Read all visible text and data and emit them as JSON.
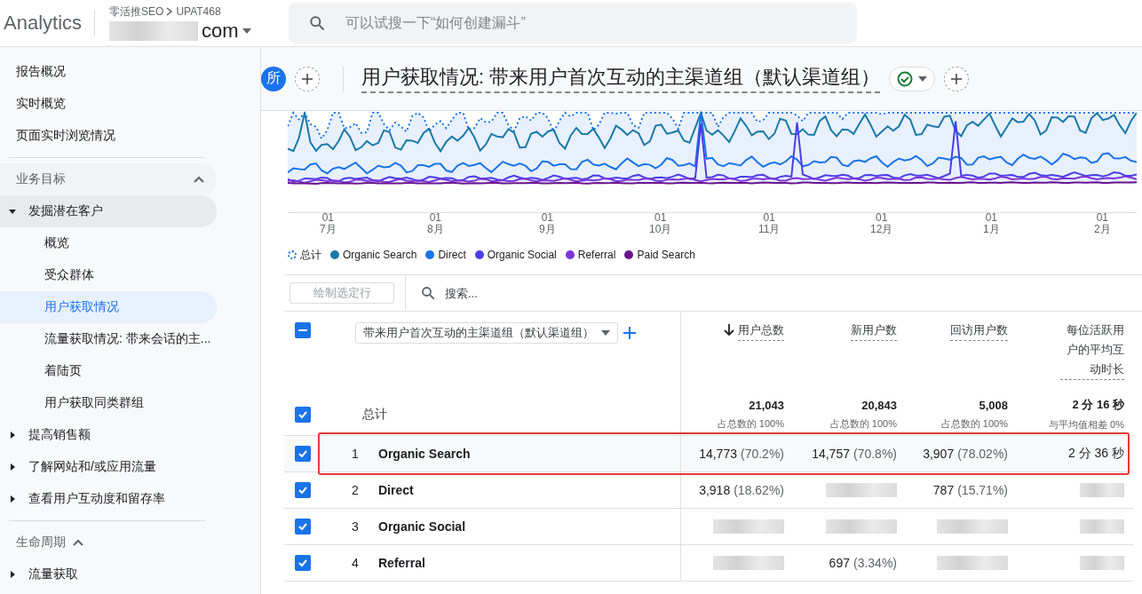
{
  "topbar": {
    "product": "Analytics",
    "breadcrumb": "零活推SEO",
    "account": "UPAT468",
    "property": "com",
    "search": {
      "placeholder": "可以试搜一下“如何创建漏斗”"
    }
  },
  "sidebar": {
    "top_items": [
      "报告概况",
      "实时概览",
      "页面实时浏览情况"
    ],
    "sections": [
      {
        "title": "业务目标",
        "expanded": true,
        "groups": [
          {
            "label": "发掘潜在客户",
            "expanded": true,
            "children": [
              {
                "label": "概览",
                "selected": false
              },
              {
                "label": "受众群体",
                "selected": false
              },
              {
                "label": "用户获取情况",
                "selected": true
              },
              {
                "label": "流量获取情况: 带来会话的主...",
                "selected": false
              },
              {
                "label": "着陆页",
                "selected": false
              },
              {
                "label": "用户获取同类群组",
                "selected": false
              }
            ]
          },
          {
            "label": "提高销售额",
            "expanded": false
          },
          {
            "label": "了解网站和/或应用流量",
            "expanded": false
          },
          {
            "label": "查看用户互动度和留存率",
            "expanded": false
          }
        ]
      },
      {
        "title": "生命周期",
        "expanded": true,
        "groups": [
          {
            "label": "流量获取",
            "expanded": false
          }
        ]
      }
    ]
  },
  "header": {
    "badge": "所",
    "title": "用户获取情况: 带来用户首次互动的主渠道组（默认渠道组）"
  },
  "chart": {
    "x_labels": [
      {
        "day": "01",
        "month": "7月"
      },
      {
        "day": "01",
        "month": "8月"
      },
      {
        "day": "01",
        "month": "9月"
      },
      {
        "day": "01",
        "month": "10月"
      },
      {
        "day": "01",
        "month": "11月"
      },
      {
        "day": "01",
        "month": "12月"
      },
      {
        "day": "01",
        "month": "1月"
      },
      {
        "day": "01",
        "month": "2月"
      }
    ],
    "legend": [
      {
        "label": "总计",
        "color": "#1a73e8",
        "kind": "dotted"
      },
      {
        "label": "Organic Search",
        "color": "#1879a8",
        "kind": "solid"
      },
      {
        "label": "Direct",
        "color": "#1a73e8",
        "kind": "solid"
      },
      {
        "label": "Organic Social",
        "color": "#4a3ee8",
        "kind": "solid"
      },
      {
        "label": "Referral",
        "color": "#7c34d8",
        "kind": "solid"
      },
      {
        "label": "Paid Search",
        "color": "#6a148f",
        "kind": "solid"
      }
    ]
  },
  "table": {
    "plot_button": "绘制选定行",
    "search_placeholder": "搜索...",
    "dimension": "带来用户首次互动的主渠道组（默认渠道组）",
    "indeterminate": true,
    "columns": [
      {
        "label": "用户总数",
        "sorted": true
      },
      {
        "label": "新用户数",
        "sorted": false
      },
      {
        "label": "回访用户数",
        "sorted": false
      },
      {
        "label": "每位活跃用户的平均互动时长",
        "sorted": false
      }
    ],
    "totals": {
      "label": "总计",
      "checked": true,
      "cells": [
        {
          "value": "21,043",
          "note": "占总数的 100%"
        },
        {
          "value": "20,843",
          "note": "占总数的 100%"
        },
        {
          "value": "5,008",
          "note": "占总数的 100%"
        },
        {
          "value": "2 分 16 秒",
          "note": "与平均值相差 0%"
        }
      ]
    },
    "rows": [
      {
        "index": "1",
        "name": "Organic Search",
        "checked": true,
        "highlighted": true,
        "cells": [
          {
            "kind": "value",
            "value": "14,773",
            "share": "(70.2%)"
          },
          {
            "kind": "value",
            "value": "14,757",
            "share": "(70.8%)"
          },
          {
            "kind": "value",
            "value": "3,907",
            "share": "(78.02%)"
          },
          {
            "kind": "value",
            "value": "2 分 36 秒"
          }
        ]
      },
      {
        "index": "2",
        "name": "Direct",
        "checked": true,
        "highlighted": false,
        "cells": [
          {
            "kind": "value",
            "value": "3,918",
            "share": "(18.62%)"
          },
          {
            "kind": "redacted"
          },
          {
            "kind": "value",
            "value": "787",
            "share": "(15.71%)"
          },
          {
            "kind": "redacted"
          }
        ]
      },
      {
        "index": "3",
        "name": "Organic Social",
        "checked": true,
        "highlighted": false,
        "cells": [
          {
            "kind": "redacted"
          },
          {
            "kind": "redacted"
          },
          {
            "kind": "redacted"
          },
          {
            "kind": "redacted"
          }
        ]
      },
      {
        "index": "4",
        "name": "Referral",
        "checked": true,
        "highlighted": false,
        "cells": [
          {
            "kind": "redacted"
          },
          {
            "kind": "value",
            "value": "697",
            "share": "(3.34%)"
          },
          {
            "kind": "redacted"
          },
          {
            "kind": "redacted"
          }
        ]
      }
    ]
  }
}
